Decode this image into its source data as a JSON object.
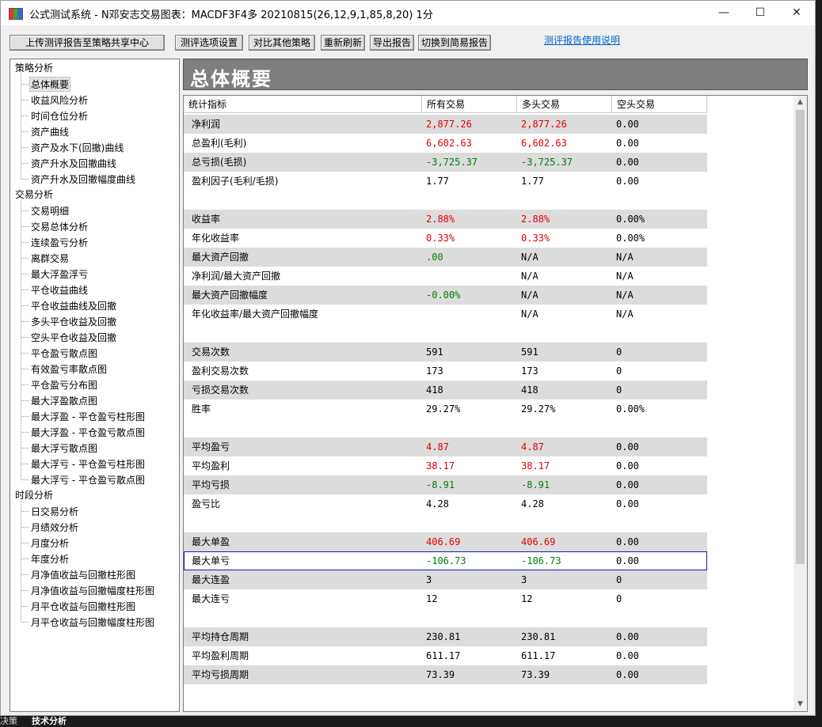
{
  "window": {
    "title": "公式测试系统 - N邓安志交易图表：MACDF3F4多 20210815(26,12,9,1,85,8,20) 1分",
    "icon": "chart-app-icon",
    "minimize": "—",
    "maximize": "☐",
    "close": "✕"
  },
  "toolbar": {
    "upload": "上传测评报告至策略共享中心",
    "options": "测评选项设置",
    "compare": "对比其他策略",
    "refresh": "重新刷新",
    "export": "导出报告",
    "simple": "切换到简易报告",
    "help_link": "测评报告使用说明"
  },
  "tree": {
    "groups": [
      {
        "label": "策略分析",
        "items": [
          "总体概要",
          "收益风险分析",
          "时间仓位分析",
          "资产曲线",
          "资产及水下(回撤)曲线",
          "资产升水及回撤曲线",
          "资产升水及回撤幅度曲线"
        ]
      },
      {
        "label": "交易分析",
        "items": [
          "交易明细",
          "交易总体分析",
          "连续盈亏分析",
          "离群交易",
          "最大浮盈浮亏",
          "平仓收益曲线",
          "平仓收益曲线及回撤",
          "多头平仓收益及回撤",
          "空头平仓收益及回撤",
          "平仓盈亏散点图",
          "有效盈亏率散点图",
          "平仓盈亏分布图",
          "最大浮盈散点图",
          "最大浮盈 - 平仓盈亏柱形图",
          "最大浮盈 - 平仓盈亏散点图",
          "最大浮亏散点图",
          "最大浮亏 - 平仓盈亏柱形图",
          "最大浮亏 - 平仓盈亏散点图"
        ]
      },
      {
        "label": "时段分析",
        "items": [
          "日交易分析",
          "月绩效分析",
          "月度分析",
          "年度分析",
          "月净值收益与回撤柱形图",
          "月净值收益与回撤幅度柱形图",
          "月平仓收益与回撤柱形图",
          "月平仓收益与回撤幅度柱形图"
        ]
      }
    ],
    "selected": "总体概要"
  },
  "header": {
    "title": "总体概要"
  },
  "table": {
    "columns": [
      "统计指标",
      "所有交易",
      "多头交易",
      "空头交易"
    ],
    "rows": [
      {
        "label": "净利润",
        "all": "2,877.26",
        "long": "2,877.26",
        "short": "0.00",
        "c1": "red",
        "c2": "red",
        "shade": true
      },
      {
        "label": "总盈利(毛利)",
        "all": "6,602.63",
        "long": "6,602.63",
        "short": "0.00",
        "c1": "red",
        "c2": "red",
        "shade": false
      },
      {
        "label": "总亏损(毛损)",
        "all": "-3,725.37",
        "long": "-3,725.37",
        "short": "0.00",
        "c1": "grn",
        "c2": "grn",
        "shade": true
      },
      {
        "label": "盈利因子(毛利/毛损)",
        "all": "1.77",
        "long": "1.77",
        "short": "0.00",
        "c1": "",
        "c2": "",
        "shade": false
      },
      {
        "label": "",
        "all": "",
        "long": "",
        "short": "",
        "c1": "",
        "c2": "",
        "shade": false
      },
      {
        "label": "收益率",
        "all": "2.88%",
        "long": "2.88%",
        "short": "0.00%",
        "c1": "red",
        "c2": "red",
        "shade": true
      },
      {
        "label": "年化收益率",
        "all": "0.33%",
        "long": "0.33%",
        "short": "0.00%",
        "c1": "red",
        "c2": "red",
        "shade": false
      },
      {
        "label": "最大资产回撤",
        "all": ".00",
        "long": "N/A",
        "short": "N/A",
        "c1": "grn",
        "c2": "",
        "shade": true
      },
      {
        "label": "净利润/最大资产回撤",
        "all": "",
        "long": "N/A",
        "short": "N/A",
        "c1": "",
        "c2": "",
        "shade": false
      },
      {
        "label": "最大资产回撤幅度",
        "all": "-0.00%",
        "long": "N/A",
        "short": "N/A",
        "c1": "grn",
        "c2": "",
        "shade": true
      },
      {
        "label": "年化收益率/最大资产回撤幅度",
        "all": "",
        "long": "N/A",
        "short": "N/A",
        "c1": "",
        "c2": "",
        "shade": false
      },
      {
        "label": "",
        "all": "",
        "long": "",
        "short": "",
        "c1": "",
        "c2": "",
        "shade": false
      },
      {
        "label": "交易次数",
        "all": "591",
        "long": "591",
        "short": "0",
        "c1": "",
        "c2": "",
        "shade": true
      },
      {
        "label": "盈利交易次数",
        "all": "173",
        "long": "173",
        "short": "0",
        "c1": "",
        "c2": "",
        "shade": false
      },
      {
        "label": "亏损交易次数",
        "all": "418",
        "long": "418",
        "short": "0",
        "c1": "",
        "c2": "",
        "shade": true
      },
      {
        "label": "胜率",
        "all": "29.27%",
        "long": "29.27%",
        "short": "0.00%",
        "c1": "",
        "c2": "",
        "shade": false
      },
      {
        "label": "",
        "all": "",
        "long": "",
        "short": "",
        "c1": "",
        "c2": "",
        "shade": false
      },
      {
        "label": "平均盈亏",
        "all": "4.87",
        "long": "4.87",
        "short": "0.00",
        "c1": "red",
        "c2": "red",
        "shade": true
      },
      {
        "label": "平均盈利",
        "all": "38.17",
        "long": "38.17",
        "short": "0.00",
        "c1": "red",
        "c2": "red",
        "shade": false
      },
      {
        "label": "平均亏损",
        "all": "-8.91",
        "long": "-8.91",
        "short": "0.00",
        "c1": "grn",
        "c2": "grn",
        "shade": true
      },
      {
        "label": "盈亏比",
        "all": "4.28",
        "long": "4.28",
        "short": "0.00",
        "c1": "",
        "c2": "",
        "shade": false
      },
      {
        "label": "",
        "all": "",
        "long": "",
        "short": "",
        "c1": "",
        "c2": "",
        "shade": false
      },
      {
        "label": "最大单盈",
        "all": "406.69",
        "long": "406.69",
        "short": "0.00",
        "c1": "red",
        "c2": "red",
        "shade": true
      },
      {
        "label": "最大单亏",
        "all": "-106.73",
        "long": "-106.73",
        "short": "0.00",
        "c1": "grn",
        "c2": "grn",
        "shade": false,
        "focus": true
      },
      {
        "label": "最大连盈",
        "all": "3",
        "long": "3",
        "short": "0",
        "c1": "",
        "c2": "",
        "shade": true
      },
      {
        "label": "最大连亏",
        "all": "12",
        "long": "12",
        "short": "0",
        "c1": "",
        "c2": "",
        "shade": false
      },
      {
        "label": "",
        "all": "",
        "long": "",
        "short": "",
        "c1": "",
        "c2": "",
        "shade": false
      },
      {
        "label": "平均持仓周期",
        "all": "230.81",
        "long": "230.81",
        "short": "0.00",
        "c1": "",
        "c2": "",
        "shade": true
      },
      {
        "label": "平均盈利周期",
        "all": "611.17",
        "long": "611.17",
        "short": "0.00",
        "c1": "",
        "c2": "",
        "shade": false
      },
      {
        "label": "平均亏损周期",
        "all": "73.39",
        "long": "73.39",
        "short": "0.00",
        "c1": "",
        "c2": "",
        "shade": true
      }
    ]
  },
  "background": {
    "bottom_tab": "技术分析",
    "bottom_left": "决策"
  }
}
